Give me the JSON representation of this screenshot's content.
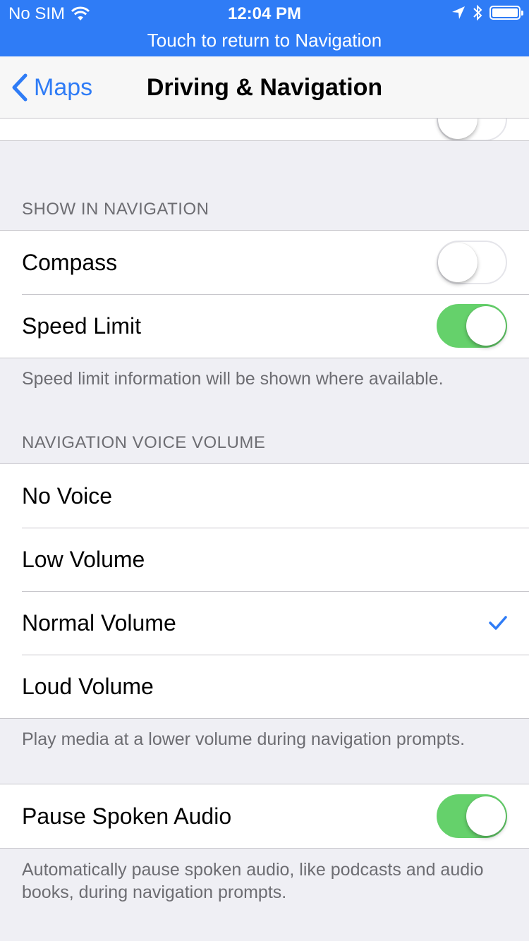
{
  "status_bar": {
    "carrier": "No SIM",
    "time": "12:04 PM",
    "return_banner": "Touch to return to Navigation",
    "background_color": "#2f7cf6"
  },
  "nav_bar": {
    "back_label": "Maps",
    "title": "Driving & Navigation",
    "accent_color": "#2f7cf6"
  },
  "show_in_navigation": {
    "header": "SHOW IN NAVIGATION",
    "compass": {
      "label": "Compass",
      "on": false
    },
    "speed_limit": {
      "label": "Speed Limit",
      "on": true
    },
    "footer": "Speed limit information will be shown where available."
  },
  "voice_volume": {
    "header": "NAVIGATION VOICE VOLUME",
    "options": [
      "No Voice",
      "Low Volume",
      "Normal Volume",
      "Loud Volume"
    ],
    "selected": "Normal Volume",
    "footer": "Play media at a lower volume during navigation prompts."
  },
  "pause_spoken_audio": {
    "label": "Pause Spoken Audio",
    "on": true,
    "footer": "Automatically pause spoken audio, like podcasts and audio books, during navigation prompts."
  },
  "switch_on_color": "#65d16b"
}
